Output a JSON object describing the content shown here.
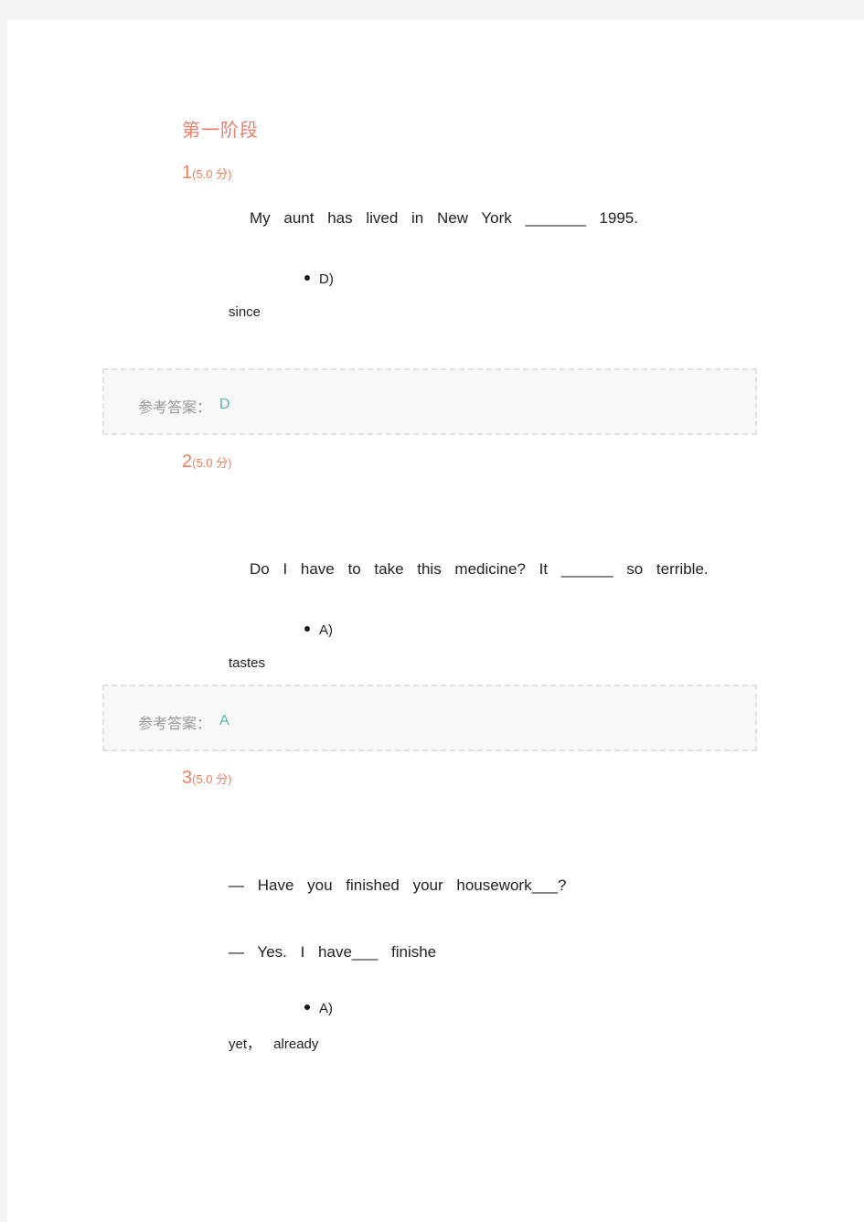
{
  "section_title": "第一阶段",
  "questions": [
    {
      "number": "1",
      "score": "(5.0 分)",
      "lines": [
        "My aunt has lived in New York _______ 1995."
      ],
      "option_label": "D)",
      "option_text": "since",
      "reference_label": "参考答案：",
      "reference_value": "D"
    },
    {
      "number": "2",
      "score": "(5.0 分)",
      "lines": [
        "Do I have to take this medicine? It ______ so terrible."
      ],
      "option_label": "A)",
      "option_text": "tastes",
      "reference_label": "参考答案：",
      "reference_value": "A"
    },
    {
      "number": "3",
      "score": "(5.0 分)",
      "lines": [
        "— Have you finished your housework___?",
        "— Yes. I have___ finishe"
      ],
      "option_label": "A)",
      "option_text": "yet， already"
    }
  ]
}
